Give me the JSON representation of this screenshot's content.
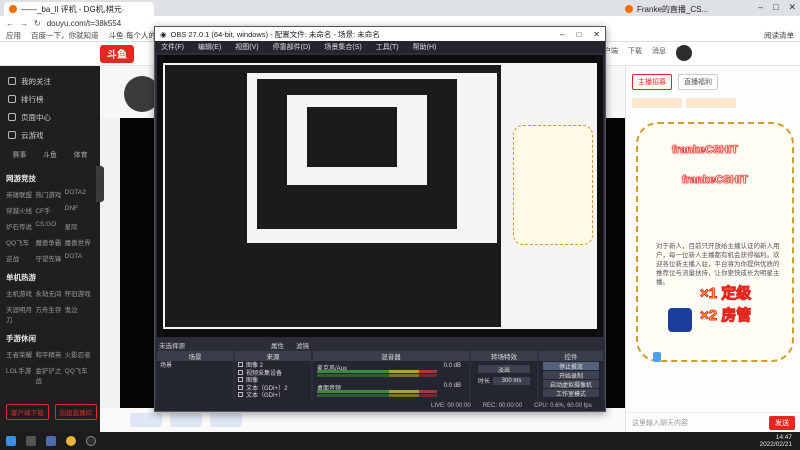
{
  "browser": {
    "tab_title": "——_ba_ll 评机 - DG机,棋元·",
    "tab2_title": "Franke的直播_CS...",
    "url": "douyu.com/t=38k554",
    "bookmarks": [
      "应用",
      "百度一下，你就知道",
      "斗鱼·每个人的直播"
    ],
    "bookmarks_right": "阅读清单"
  },
  "site": {
    "logo": "斗鱼",
    "header_links": [
      "客户端",
      "下载",
      "消息",
      "历史"
    ]
  },
  "sidebar": {
    "main": [
      "我的关注",
      "排行榜",
      "页面中心",
      "云游戏"
    ],
    "icons": [
      "赛事",
      "斗鱼",
      "体育"
    ],
    "sections": [
      {
        "title": "网游竞技",
        "items": [
          "英雄联盟",
          "热门游戏",
          "DOTA2",
          "穿越火线",
          "CF手",
          "DNF",
          "炉石传说",
          "CS:GO",
          "星际",
          "QQ飞车",
          "魔兽争霸",
          "魔兽世界",
          "逆战",
          "守望先锋",
          "DOTA",
          "魔兽世界",
          "天涯明月刀",
          "APEX英雄"
        ]
      },
      {
        "title": "单机热游",
        "items": [
          "主机游戏",
          "永劫无间",
          "怀旧游戏",
          "天涯明月刀",
          "方舟生存",
          "鬼泣",
          "我的世界",
          "饥荒",
          "其他单机"
        ]
      },
      {
        "title": "手游休闲",
        "items": [
          "王者荣耀",
          "和平精英",
          "火影忍者",
          "LOL手游",
          "金铲铲之战",
          "QQ飞车",
          "COD手游",
          "崩坏3",
          "CF手游",
          "跑跑卡丁车",
          "原神",
          "天刀手游"
        ]
      }
    ],
    "buttons": [
      "客户端下载",
      "创建直播间"
    ]
  },
  "obs": {
    "title": "OBS 27.0.1 (64-bit, windows) - 配置文件: 未命名 - 场景: 未命名",
    "menu": [
      "文件(F)",
      "编辑(E)",
      "视图(V)",
      "停靠部件(D)",
      "场景集合(S)",
      "工具(T)",
      "帮助(H)"
    ],
    "source_bar": "未选择源",
    "bar_buttons": [
      "属性",
      "滤镜"
    ],
    "docks": [
      "场景",
      "来源",
      "混音器",
      "转场特效",
      "控件"
    ],
    "scenes": [
      "场景"
    ],
    "sources": [
      "图像 2",
      "视频采集设备",
      "图像",
      "文本（GDI+）2",
      "文本（GDI+）",
      "显示器采集"
    ],
    "mixer": [
      {
        "label": "麦克风/Aux",
        "db": "0.0 dB"
      },
      {
        "label": "桌面音频",
        "db": "0.0 dB"
      }
    ],
    "transition": {
      "type": "淡出",
      "duration_label": "时长",
      "duration": "300 ms"
    },
    "controls": [
      "停止推流",
      "开始录制",
      "启动虚拟摄像机",
      "工作室模式",
      "设置",
      "退出"
    ],
    "status": [
      "LIVE: 00:00:00",
      "REC: 00:00:00",
      "CPU: 0.6%, 60.00 fps"
    ]
  },
  "chat": {
    "tabs": [
      "主播招募",
      "直播福利"
    ],
    "card_name": "frankeCSHIT",
    "card_text": "对于新人，目前只开放给主播认证的新人用户，每一位新人主播都有机会获得福利。欢迎各位新主播入驻，平台将为你提供优质的推荐位与流量扶持，让你更快成长为明星主播。",
    "card_big1": "×1 定级",
    "card_big2": "×2 房管",
    "input_placeholder": "这里输入聊天内容",
    "send": "发送"
  },
  "taskbar": {
    "time": "14:47",
    "date": "2022/02/21"
  }
}
